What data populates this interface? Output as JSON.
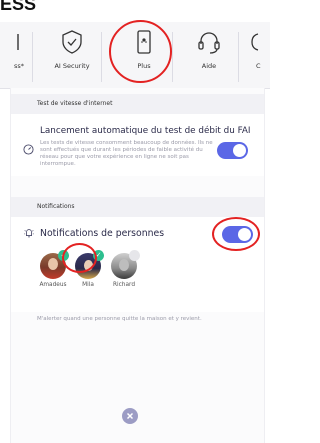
{
  "top_fragment": "ESS",
  "nav": {
    "items": [
      {
        "label": "ss*",
        "icon": "partial-icon"
      },
      {
        "label": "AI Security",
        "icon": "shield-check-icon"
      },
      {
        "label": "Plus",
        "icon": "device-icon"
      },
      {
        "label": "Aide",
        "icon": "headset-icon"
      },
      {
        "label": "C",
        "icon": "partial-icon"
      }
    ]
  },
  "speedtest": {
    "section_title": "Test de vitesse d'internet",
    "title": "Lancement automatique du test de débit du FAI",
    "description": "Les tests de vitesse consomment beaucoup de données. Ils ne sont effectués que durant les périodes de faible activité du réseau pour que votre expérience en ligne ne soit pas interrompue.",
    "toggle_on": true
  },
  "notifications": {
    "section_title": "Notifications",
    "title": "Notifications de personnes",
    "toggle_on": true,
    "people": [
      {
        "name": "Amadeus",
        "checked": true
      },
      {
        "name": "Mila",
        "checked": true
      },
      {
        "name": "Richard",
        "checked": false
      }
    ],
    "description": "M'alerter quand une personne quitte la maison et y revient."
  },
  "colors": {
    "accent": "#5b67e6",
    "check": "#2dbf8f",
    "annotation": "#e32222"
  }
}
